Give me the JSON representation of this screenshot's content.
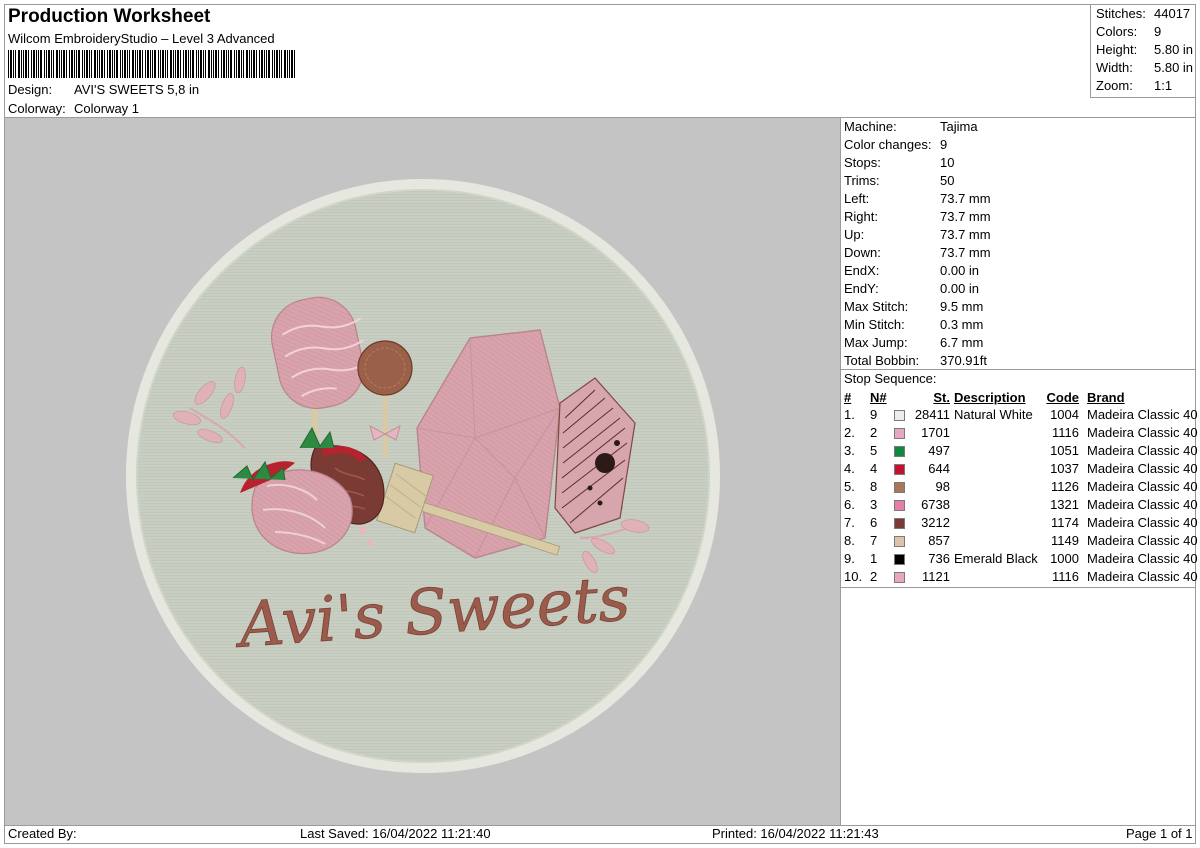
{
  "header": {
    "title": "Production Worksheet",
    "software": "Wilcom EmbroideryStudio – Level 3 Advanced",
    "design_label": "Design:",
    "design_value": "AVI'S SWEETS 5,8 in",
    "colorway_label": "Colorway:",
    "colorway_value": "Colorway 1"
  },
  "stats": [
    {
      "label": "Stitches:",
      "value": "44017"
    },
    {
      "label": "Colors:",
      "value": "9"
    },
    {
      "label": "Height:",
      "value": "5.80 in"
    },
    {
      "label": "Width:",
      "value": "5.80 in"
    },
    {
      "label": "Zoom:",
      "value": "1:1"
    }
  ],
  "machine_info": [
    {
      "label": "Machine:",
      "value": "Tajima"
    },
    {
      "label": "Color changes:",
      "value": "9"
    },
    {
      "label": "Stops:",
      "value": "10"
    },
    {
      "label": "Trims:",
      "value": "50"
    },
    {
      "label": "Left:",
      "value": "73.7 mm"
    },
    {
      "label": "Right:",
      "value": "73.7 mm"
    },
    {
      "label": "Up:",
      "value": "73.7 mm"
    },
    {
      "label": "Down:",
      "value": "73.7 mm"
    },
    {
      "label": "EndX:",
      "value": "0.00 in"
    },
    {
      "label": "EndY:",
      "value": "0.00 in"
    },
    {
      "label": "Max Stitch:",
      "value": "9.5 mm"
    },
    {
      "label": "Min Stitch:",
      "value": "0.3 mm"
    },
    {
      "label": "Max Jump:",
      "value": "6.7 mm"
    },
    {
      "label": "Total Bobbin:",
      "value": "370.91ft"
    }
  ],
  "stop_sequence": {
    "title": "Stop Sequence:",
    "columns": [
      "#",
      "N#",
      "St.",
      "Description",
      "Code",
      "Brand"
    ],
    "rows": [
      {
        "idx": "1.",
        "n": "9",
        "color": "#ececec",
        "st": "28411",
        "desc": "Natural White",
        "code": "1004",
        "brand": "Madeira Classic 40"
      },
      {
        "idx": "2.",
        "n": "2",
        "color": "#e8a6bf",
        "st": "1701",
        "desc": "",
        "code": "1116",
        "brand": "Madeira Classic 40"
      },
      {
        "idx": "3.",
        "n": "5",
        "color": "#0f8a3c",
        "st": "497",
        "desc": "",
        "code": "1051",
        "brand": "Madeira Classic 40"
      },
      {
        "idx": "4.",
        "n": "4",
        "color": "#c8102e",
        "st": "644",
        "desc": "",
        "code": "1037",
        "brand": "Madeira Classic 40"
      },
      {
        "idx": "5.",
        "n": "8",
        "color": "#a8775a",
        "st": "98",
        "desc": "",
        "code": "1126",
        "brand": "Madeira Classic 40"
      },
      {
        "idx": "6.",
        "n": "3",
        "color": "#e37fa8",
        "st": "6738",
        "desc": "",
        "code": "1321",
        "brand": "Madeira Classic 40"
      },
      {
        "idx": "7.",
        "n": "6",
        "color": "#7b3b35",
        "st": "3212",
        "desc": "",
        "code": "1174",
        "brand": "Madeira Classic 40"
      },
      {
        "idx": "8.",
        "n": "7",
        "color": "#ddc3a8",
        "st": "857",
        "desc": "",
        "code": "1149",
        "brand": "Madeira Classic 40"
      },
      {
        "idx": "9.",
        "n": "1",
        "color": "#000000",
        "st": "736",
        "desc": "Emerald Black",
        "code": "1000",
        "brand": "Madeira Classic 40"
      },
      {
        "idx": "10.",
        "n": "2",
        "color": "#e8a6bf",
        "st": "1121",
        "desc": "",
        "code": "1116",
        "brand": "Madeira Classic 40"
      }
    ]
  },
  "preview": {
    "design_text": "Avi's Sweets",
    "colors": {
      "background": "#c4c4c4",
      "patch_fill": "#c9cfc3",
      "patch_border": "#e6e8df",
      "pink": "#d9a3ad",
      "chocolate": "#8a4e3e",
      "text": "#9a5a4c",
      "green": "#2e8a42",
      "red": "#b8222f",
      "tan": "#d8caa4"
    }
  },
  "footer": {
    "created_by": "Created By:",
    "last_saved": "Last Saved: 16/04/2022 11:21:40",
    "printed": "Printed: 16/04/2022 11:21:43",
    "page": "Page 1 of 1"
  }
}
